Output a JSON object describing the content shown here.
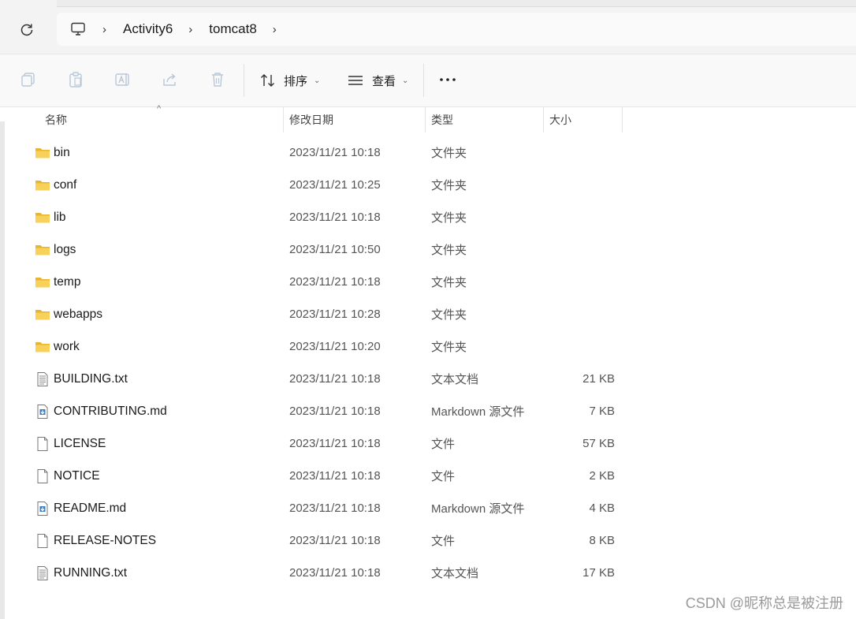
{
  "breadcrumb": {
    "items": [
      {
        "label": "Activity6"
      },
      {
        "label": "tomcat8"
      }
    ]
  },
  "toolbar": {
    "sort_label": "排序",
    "view_label": "查看"
  },
  "columns": {
    "name": "名称",
    "modified": "修改日期",
    "type": "类型",
    "size": "大小"
  },
  "files": [
    {
      "name": "bin",
      "modified": "2023/11/21 10:18",
      "type": "文件夹",
      "size": "",
      "icon": "folder"
    },
    {
      "name": "conf",
      "modified": "2023/11/21 10:25",
      "type": "文件夹",
      "size": "",
      "icon": "folder"
    },
    {
      "name": "lib",
      "modified": "2023/11/21 10:18",
      "type": "文件夹",
      "size": "",
      "icon": "folder"
    },
    {
      "name": "logs",
      "modified": "2023/11/21 10:50",
      "type": "文件夹",
      "size": "",
      "icon": "folder"
    },
    {
      "name": "temp",
      "modified": "2023/11/21 10:18",
      "type": "文件夹",
      "size": "",
      "icon": "folder"
    },
    {
      "name": "webapps",
      "modified": "2023/11/21 10:28",
      "type": "文件夹",
      "size": "",
      "icon": "folder"
    },
    {
      "name": "work",
      "modified": "2023/11/21 10:20",
      "type": "文件夹",
      "size": "",
      "icon": "folder"
    },
    {
      "name": "BUILDING.txt",
      "modified": "2023/11/21 10:18",
      "type": "文本文档",
      "size": "21 KB",
      "icon": "text"
    },
    {
      "name": "CONTRIBUTING.md",
      "modified": "2023/11/21 10:18",
      "type": "Markdown 源文件",
      "size": "7 KB",
      "icon": "markdown"
    },
    {
      "name": "LICENSE",
      "modified": "2023/11/21 10:18",
      "type": "文件",
      "size": "57 KB",
      "icon": "file"
    },
    {
      "name": "NOTICE",
      "modified": "2023/11/21 10:18",
      "type": "文件",
      "size": "2 KB",
      "icon": "file"
    },
    {
      "name": "README.md",
      "modified": "2023/11/21 10:18",
      "type": "Markdown 源文件",
      "size": "4 KB",
      "icon": "markdown"
    },
    {
      "name": "RELEASE-NOTES",
      "modified": "2023/11/21 10:18",
      "type": "文件",
      "size": "8 KB",
      "icon": "file"
    },
    {
      "name": "RUNNING.txt",
      "modified": "2023/11/21 10:18",
      "type": "文本文档",
      "size": "17 KB",
      "icon": "text"
    }
  ],
  "watermark": "CSDN @昵称总是被注册",
  "colors": {
    "folder": "#f4c430",
    "folder_dark": "#e0a820",
    "accent": "#3b7dbf"
  }
}
